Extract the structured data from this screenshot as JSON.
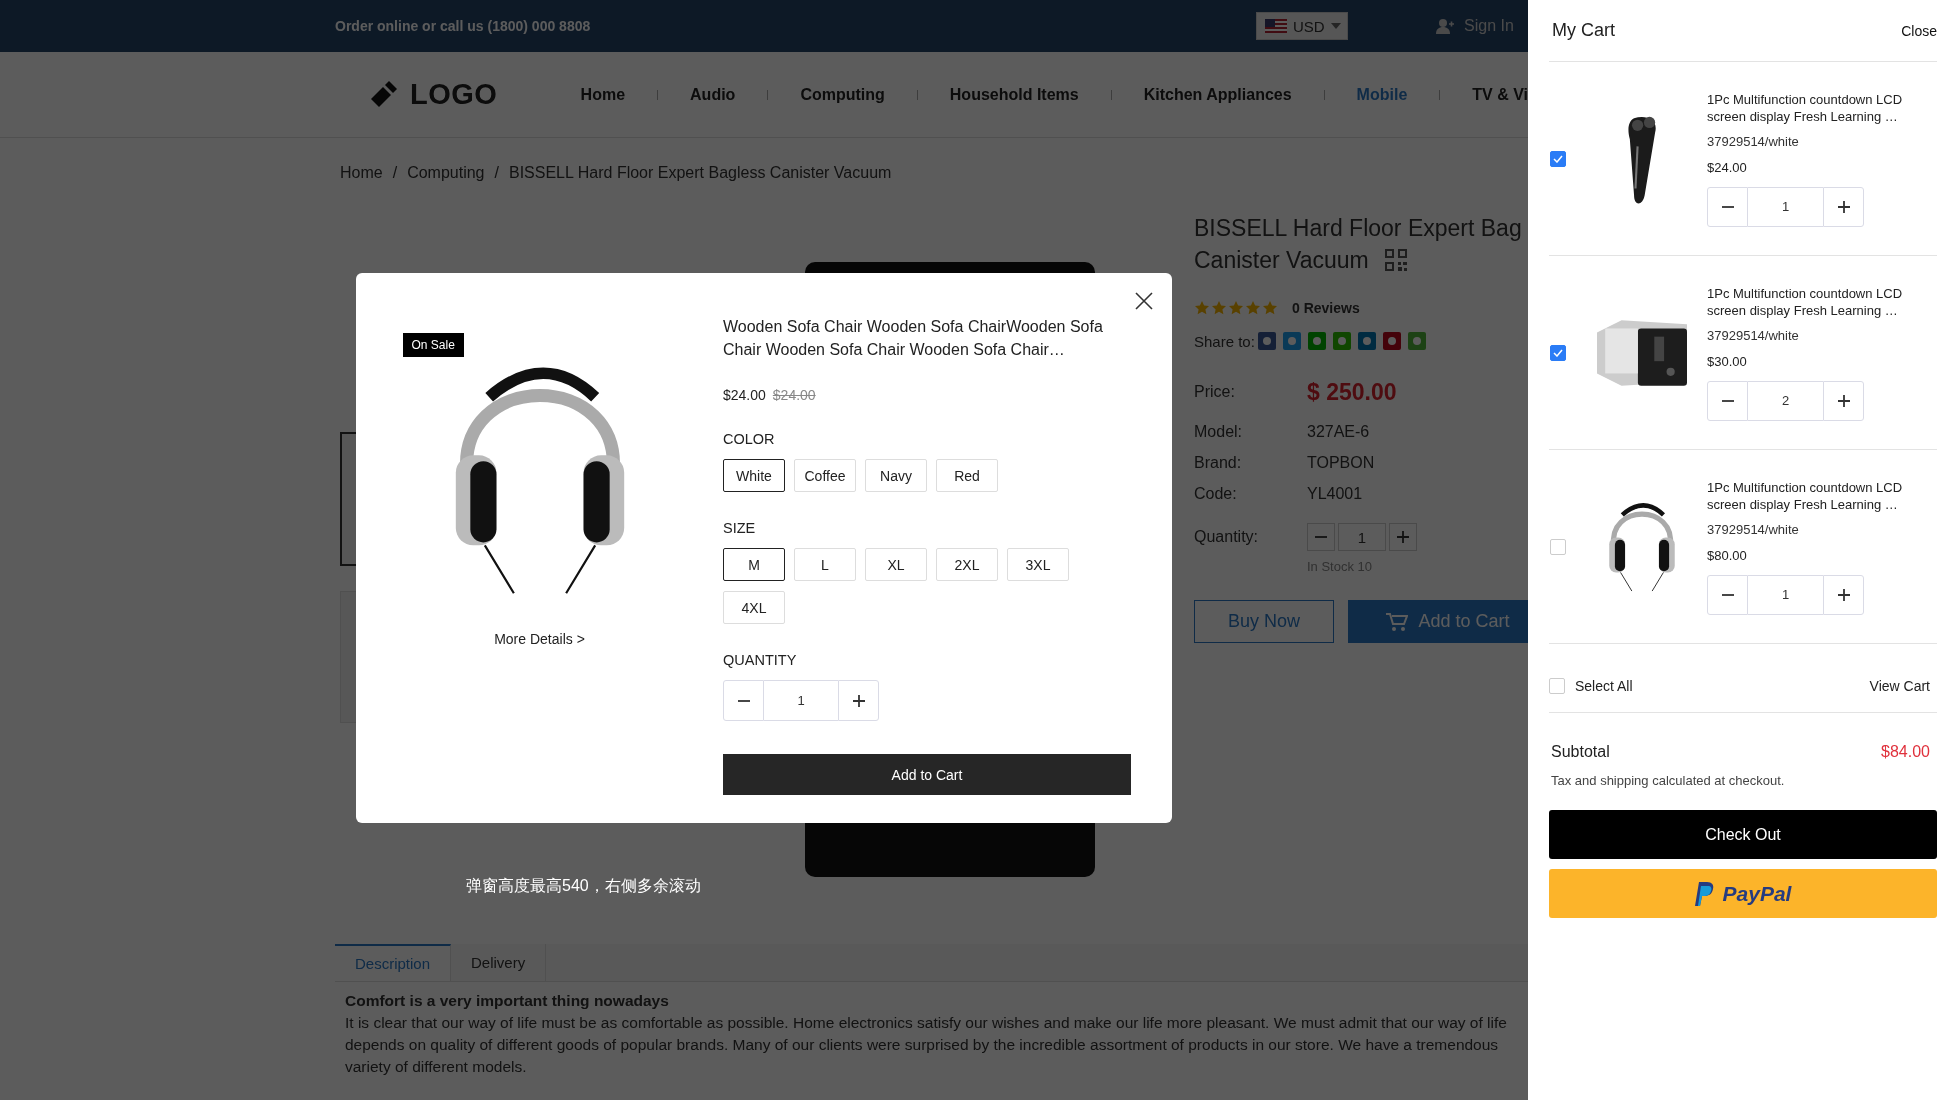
{
  "topbar": {
    "contact": "Order online or call us (1800) 000 8808",
    "currency": "USD",
    "sign_in": "Sign In"
  },
  "logo": "LOGO",
  "nav": [
    {
      "label": "Home",
      "selected": false
    },
    {
      "label": "Audio",
      "selected": false
    },
    {
      "label": "Computing",
      "selected": false
    },
    {
      "label": "Household Items",
      "selected": false
    },
    {
      "label": "Kitchen Appliances",
      "selected": false
    },
    {
      "label": "Mobile",
      "selected": true
    },
    {
      "label": "TV & Vi",
      "selected": false
    }
  ],
  "breadcrumb": {
    "items": [
      "Home",
      "Computing",
      "BISSELL Hard Floor Expert Bagless Canister Vacuum"
    ],
    "separators": [
      "/",
      "/"
    ]
  },
  "product": {
    "title_lines": [
      "BISSELL Hard Floor Expert Bag",
      "Canister Vacuum"
    ],
    "stars": 5,
    "reviews": "0 Reviews",
    "share_label": "Share to:",
    "price_label": "Price:",
    "price": "$ 250.00",
    "specs": [
      {
        "label": "Model:",
        "value": "327AE-6"
      },
      {
        "label": "Brand:",
        "value": "TOPBON"
      },
      {
        "label": "Code:",
        "value": "YL4001"
      }
    ],
    "quantity_label": "Quantity:",
    "quantity": "1",
    "stock": "In Stock 10",
    "buy_now": "Buy Now",
    "add_to_cart": "Add to Cart"
  },
  "tabs": [
    {
      "label": "Description",
      "selected": true
    },
    {
      "label": "Delivery",
      "selected": false
    }
  ],
  "description": {
    "heading": "Comfort is a very important thing nowadays",
    "body": "It is clear that our way of life must be as comfortable as possible. Home electronics satisfy our wishes and make our life more pleasant. We must admit that our way of life depends on quality of different goods of popular brands. Many of our clients were surprised by the incredible assortment of products in our store. We have a tremendous variety of different models."
  },
  "note": "弹窗高度最高540，右侧多余滚动",
  "modal": {
    "badge": "On Sale",
    "more_details": "More Details >",
    "title": "Wooden Sofa Chair Wooden Sofa ChairWooden Sofa Chair Wooden Sofa Chair Wooden Sofa Chair…",
    "price": "$24.00",
    "old_price": "$24.00",
    "color_label": "COLOR",
    "colors": [
      {
        "label": "White",
        "selected": true
      },
      {
        "label": "Coffee",
        "selected": false
      },
      {
        "label": "Navy",
        "selected": false
      },
      {
        "label": "Red",
        "selected": false
      }
    ],
    "size_label": "SIZE",
    "sizes": [
      {
        "label": "M",
        "selected": true
      },
      {
        "label": "L",
        "selected": false
      },
      {
        "label": "XL",
        "selected": false
      },
      {
        "label": "2XL",
        "selected": false
      },
      {
        "label": "3XL",
        "selected": false
      },
      {
        "label": "4XL",
        "selected": false
      }
    ],
    "quantity_label": "QUANTITY",
    "quantity": "1",
    "add_to_cart": "Add to Cart"
  },
  "cart": {
    "title": "My Cart",
    "close": "Close",
    "items": [
      {
        "name": "1Pc Multifunction countdown LCD screen display Fresh Learning …",
        "sku": "37929514/white",
        "price": "$24.00",
        "quantity": "1",
        "checked": true
      },
      {
        "name": "1Pc Multifunction countdown LCD screen display Fresh Learning …",
        "sku": "37929514/white",
        "price": "$30.00",
        "quantity": "2",
        "checked": true
      },
      {
        "name": "1Pc Multifunction countdown LCD screen display Fresh Learning …",
        "sku": "37929514/white",
        "price": "$80.00",
        "quantity": "1",
        "checked": false
      }
    ],
    "select_all": {
      "label": "Select All",
      "checked": false
    },
    "view_cart": "View Cart",
    "subtotal_label": "Subtotal",
    "subtotal": "$84.00",
    "tax_note": "Tax and shipping calculated at checkout.",
    "checkout": "Check Out",
    "paypal": "PayPal"
  }
}
